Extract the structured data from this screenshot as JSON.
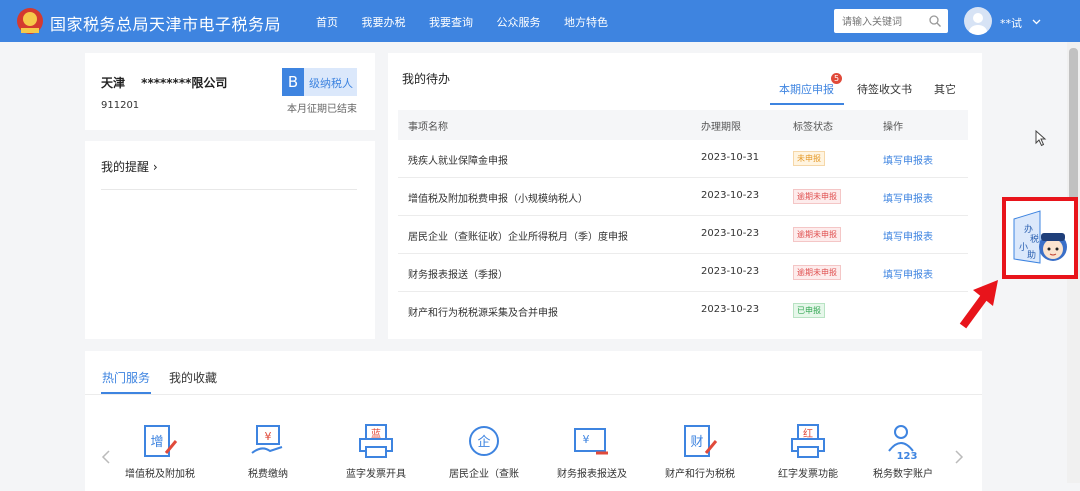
{
  "header": {
    "brand": "国家税务总局天津市电子税务局",
    "nav": [
      "首页",
      "我要办税",
      "我要查询",
      "公众服务",
      "地方特色"
    ],
    "search_placeholder": "请输入关键词",
    "user_name": "**试"
  },
  "company": {
    "name": "天津　 ********限公司",
    "code": "911201",
    "level_letter": "B",
    "level_label": "级纳税人",
    "status": "本月征期已结束"
  },
  "reminder": {
    "title": "我的提醒 ›"
  },
  "todo": {
    "title": "我的待办",
    "tabs": [
      "本期应申报",
      "待签收文书",
      "其它"
    ],
    "tab_count": "5",
    "columns": [
      "事项名称",
      "办理期限",
      "标签状态",
      "操作"
    ],
    "rows": [
      {
        "name": "残疾人就业保障金申报",
        "deadline": "2023-10-31",
        "status": "未申报",
        "status_kind": "none",
        "action": "填写申报表"
      },
      {
        "name": "增值税及附加税费申报（小规模纳税人）",
        "deadline": "2023-10-23",
        "status": "逾期未申报",
        "status_kind": "late",
        "action": "填写申报表"
      },
      {
        "name": "居民企业（查账征收）企业所得税月（季）度申报",
        "deadline": "2023-10-23",
        "status": "逾期未申报",
        "status_kind": "late",
        "action": "填写申报表"
      },
      {
        "name": "财务报表报送（季报）",
        "deadline": "2023-10-23",
        "status": "逾期未申报",
        "status_kind": "late",
        "action": "填写申报表"
      },
      {
        "name": "财产和行为税税源采集及合并申报",
        "deadline": "2023-10-23",
        "status": "已申报",
        "status_kind": "done",
        "action": ""
      }
    ]
  },
  "services": {
    "tabs": [
      "热门服务",
      "我的收藏"
    ],
    "items": [
      {
        "icon_char": "增",
        "label": "增值税及附加税"
      },
      {
        "icon_char": "¥",
        "label": "税费缴纳"
      },
      {
        "icon_char": "蓝",
        "label": "蓝字发票开具"
      },
      {
        "icon_char": "企",
        "label": "居民企业（查账"
      },
      {
        "icon_char": "¥",
        "label": "财务报表报送及"
      },
      {
        "icon_char": "财",
        "label": "财产和行为税税"
      },
      {
        "icon_char": "红",
        "label": "红字发票功能"
      },
      {
        "icon_char": "123",
        "label": "税务数字账户"
      }
    ]
  },
  "mascot_label": "办税小助"
}
